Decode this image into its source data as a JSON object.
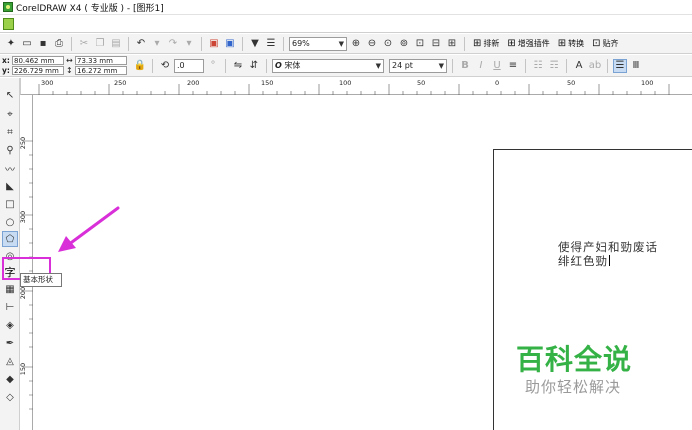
{
  "window": {
    "title": "CorelDRAW X4 ( 专业版 ) - [图形1]"
  },
  "toolbar": {
    "zoom": "69%",
    "labels": [
      "排新",
      "增强插件",
      "转换",
      "贴齐"
    ]
  },
  "property_bar": {
    "x_label": "x:",
    "x_value": "80.462 mm",
    "y_label": "y:",
    "y_value": "226.729 mm",
    "w_value": "73.33 mm",
    "h_value": "16.272 mm",
    "angle": ".0",
    "angle_unit": "°",
    "font": "宋体",
    "font_size": "24 pt"
  },
  "ruler": {
    "top_labels": [
      "300",
      "250",
      "200",
      "150",
      "100",
      "50",
      "0",
      "50",
      "100"
    ],
    "left_labels": [
      "250",
      "300",
      "200",
      "150"
    ]
  },
  "tooltip": "基本形状",
  "text_tool_glyph": "字",
  "document_text": {
    "line1": "使得产妇和勁废话",
    "line2": "绯红色勁"
  },
  "watermark": {
    "title": "百科全说",
    "subtitle": "助你轻松解决"
  },
  "colors": {
    "highlight": "#d82fd8",
    "watermark_green": "#35b246"
  }
}
